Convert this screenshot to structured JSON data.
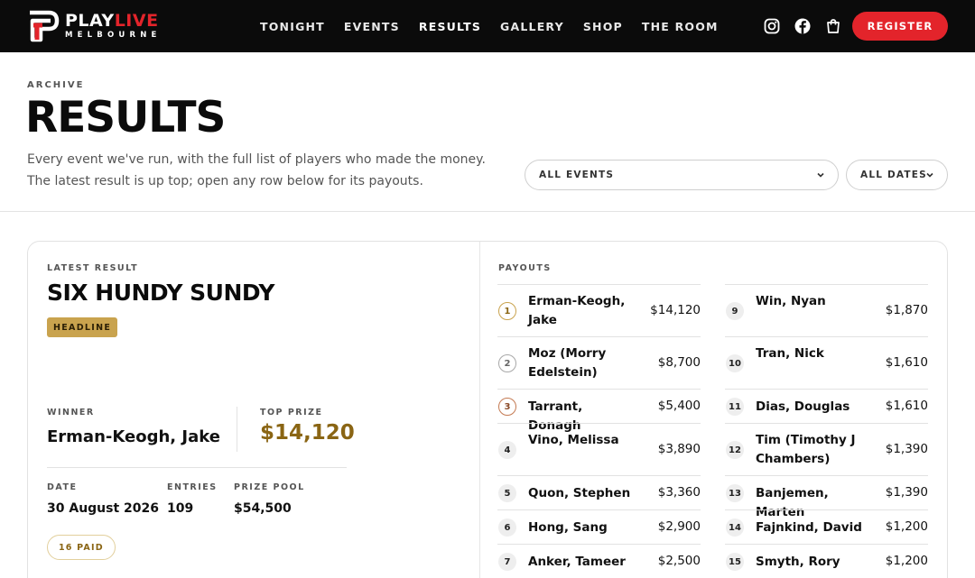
{
  "brand": {
    "word_a": "PLAY",
    "word_b": "LIVE",
    "sub": "MELBOURNE",
    "accent": "#e3242b"
  },
  "nav": [
    "TONIGHT",
    "EVENTS",
    "RESULTS",
    "GALLERY",
    "SHOP",
    "THE ROOM"
  ],
  "nav_active": "RESULTS",
  "header_icons": [
    "instagram-icon",
    "facebook-icon",
    "cart-icon"
  ],
  "register_label": "REGISTER",
  "hero": {
    "eyebrow": "ARCHIVE",
    "title": "RESULTS",
    "intro_line1": "Every event we've run, with the full list of players who made the money.",
    "intro_line2": "The latest result is up top; open any row below for its payouts."
  },
  "filters": {
    "events": "ALL EVENTS",
    "dates": "ALL DATES"
  },
  "latest": {
    "eyebrow": "LATEST RESULT",
    "title": "SIX HUNDY SUNDY",
    "tag": "HEADLINE",
    "winner_label": "WINNER",
    "winner": "Erman-Keogh, Jake",
    "top_prize_label": "TOP PRIZE",
    "top_prize": "$14,120",
    "date_label": "DATE",
    "date": "30 August 2026",
    "entries_label": "ENTRIES",
    "entries": "109",
    "pool_label": "PRIZE POOL",
    "pool": "$54,500",
    "paid": "16 PAID"
  },
  "payouts_label": "PAYOUTS",
  "payouts_left": [
    {
      "rank": "1",
      "name": "Erman-Keogh, Jake",
      "amount": "$14,120",
      "medal": "gold"
    },
    {
      "rank": "2",
      "name": "Moz (Morry Edelstein)",
      "amount": "$8,700",
      "medal": "silver"
    },
    {
      "rank": "3",
      "name": "Tarrant, Donagh",
      "amount": "$5,400",
      "medal": "bronze"
    },
    {
      "rank": "4",
      "name": "Vino, Melissa",
      "amount": "$3,890",
      "medal": "plain"
    },
    {
      "rank": "5",
      "name": "Quon, Stephen",
      "amount": "$3,360",
      "medal": "plain"
    },
    {
      "rank": "6",
      "name": "Hong, Sang",
      "amount": "$2,900",
      "medal": "plain"
    },
    {
      "rank": "7",
      "name": "Anker, Tameer",
      "amount": "$2,500",
      "medal": "plain"
    }
  ],
  "payouts_right": [
    {
      "rank": "9",
      "name": "Win, Nyan",
      "amount": "$1,870",
      "medal": "plain"
    },
    {
      "rank": "10",
      "name": "Tran, Nick",
      "amount": "$1,610",
      "medal": "plain"
    },
    {
      "rank": "11",
      "name": "Dias, Douglas",
      "amount": "$1,610",
      "medal": "plain"
    },
    {
      "rank": "12",
      "name": "Tim (Timothy J Chambers)",
      "amount": "$1,390",
      "medal": "plain"
    },
    {
      "rank": "13",
      "name": "Banjemen, Marten",
      "amount": "$1,390",
      "medal": "plain"
    },
    {
      "rank": "14",
      "name": "Fajnkind, David",
      "amount": "$1,200",
      "medal": "plain"
    },
    {
      "rank": "15",
      "name": "Smyth, Rory",
      "amount": "$1,200",
      "medal": "plain"
    }
  ]
}
